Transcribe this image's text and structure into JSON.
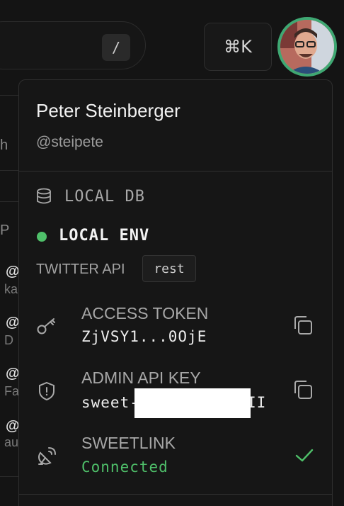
{
  "topbar": {
    "search_shortcut": "/",
    "command_shortcut": "⌘K"
  },
  "background_list": {
    "fragments": [
      "h",
      "P"
    ],
    "items": [
      {
        "at": "@",
        "sub": "ka"
      },
      {
        "at": "@",
        "sub": "D"
      },
      {
        "at": "@",
        "sub": "Fa"
      },
      {
        "at": "@",
        "sub": "au"
      }
    ]
  },
  "menu": {
    "user_name": "Peter Steinberger",
    "user_handle": "@steipete",
    "db_label": "LOCAL DB",
    "env_label": "LOCAL ENV",
    "env_status_color": "#4fc06a",
    "api_label": "TWITTER API",
    "api_mode": "rest",
    "access_token": {
      "title": "ACCESS TOKEN",
      "value": "ZjVSY1...0OjE",
      "icon": "key-icon"
    },
    "admin_key": {
      "title": "ADMIN API KEY",
      "value_prefix": "sweet-",
      "value_suffix": "II",
      "icon": "shield-icon"
    },
    "sweetlink": {
      "title": "SWEETLINK",
      "status": "Connected",
      "icon": "satellite-icon",
      "status_color": "#4fc06a"
    }
  },
  "colors": {
    "accent_green": "#4fc06a",
    "avatar_ring": "#3fa873",
    "background": "#141414"
  }
}
